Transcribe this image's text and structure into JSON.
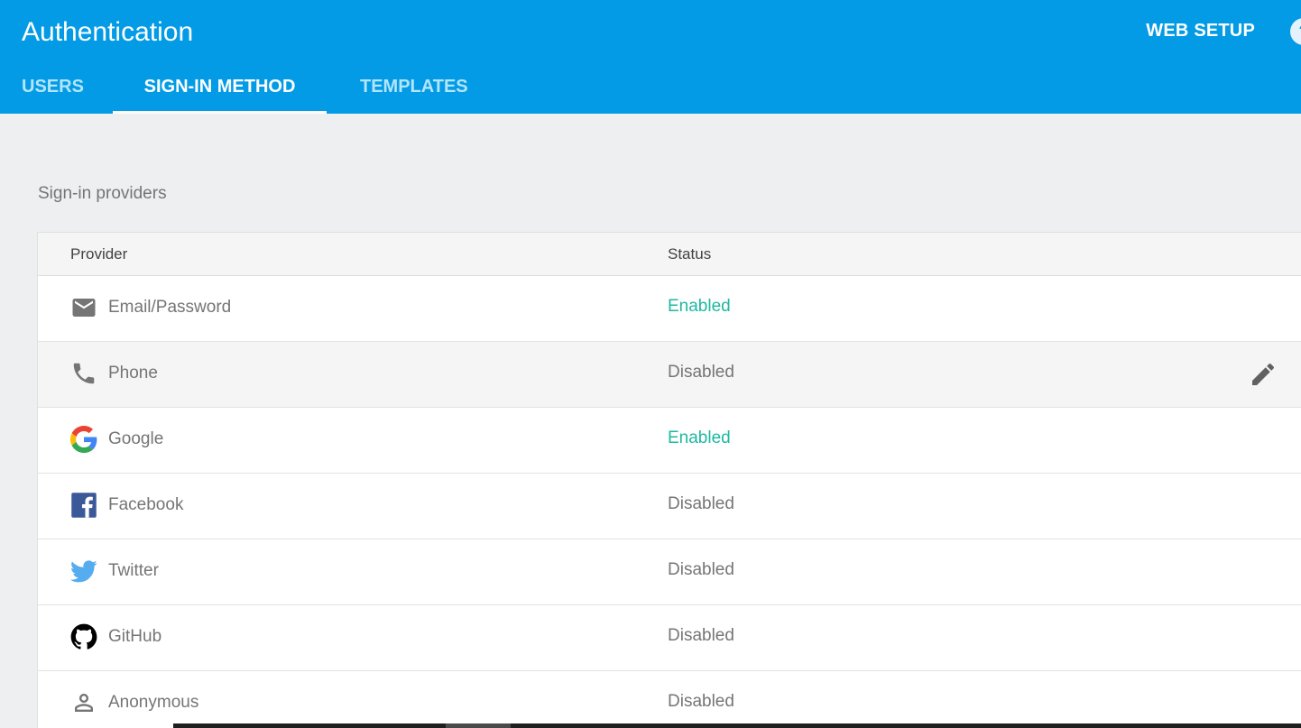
{
  "header": {
    "title": "Authentication",
    "web_setup_label": "WEB SETUP",
    "help_label": "?",
    "background_color": "#039be5"
  },
  "tabs": [
    {
      "label": "USERS",
      "active": false
    },
    {
      "label": "SIGN-IN METHOD",
      "active": true
    },
    {
      "label": "TEMPLATES",
      "active": false
    }
  ],
  "section_label": "Sign-in providers",
  "table": {
    "columns": [
      "Provider",
      "Status"
    ],
    "rows": [
      {
        "name": "Email/Password",
        "status": "Enabled",
        "icon": "email-icon"
      },
      {
        "name": "Phone",
        "status": "Disabled",
        "icon": "phone-icon"
      },
      {
        "name": "Google",
        "status": "Enabled",
        "icon": "google-icon"
      },
      {
        "name": "Facebook",
        "status": "Disabled",
        "icon": "facebook-icon"
      },
      {
        "name": "Twitter",
        "status": "Disabled",
        "icon": "twitter-icon"
      },
      {
        "name": "GitHub",
        "status": "Disabled",
        "icon": "github-icon"
      },
      {
        "name": "Anonymous",
        "status": "Disabled",
        "icon": "person-icon"
      }
    ],
    "hovered_row": 1,
    "hover_action_icon": "edit-pencil-icon"
  },
  "colors": {
    "enabled": "#1db9a0",
    "disabled": "#757575",
    "page_background": "#eeeff0"
  }
}
